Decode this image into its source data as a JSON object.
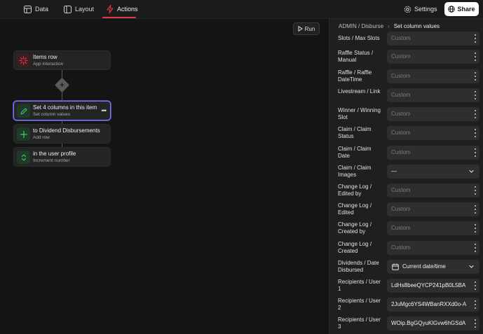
{
  "topbar": {
    "tabs": [
      {
        "label": "Data",
        "icon": "table-icon"
      },
      {
        "label": "Layout",
        "icon": "layout-icon"
      },
      {
        "label": "Actions",
        "icon": "lightning-icon",
        "active": true
      }
    ],
    "settings_label": "Settings",
    "share_label": "Share",
    "accent_color": "#e0393e"
  },
  "canvas": {
    "run_label": "Run",
    "nodes": [
      {
        "title": "Items row",
        "subtitle": "App interaction",
        "icon": "trigger-icon",
        "icon_color": "#e0393e"
      },
      {
        "title": "Set 4 columns in this item",
        "subtitle": "Set column values",
        "icon": "pencil-icon",
        "icon_color": "#3ec46d",
        "selected": true
      },
      {
        "title": "to Dividend Disbursements",
        "subtitle": "Add row",
        "icon": "plus-icon",
        "icon_color": "#3ec46d"
      },
      {
        "title": "in the user profile",
        "subtitle": "Increment number",
        "icon": "stepper-icon",
        "icon_color": "#3ec46d"
      }
    ]
  },
  "panel": {
    "breadcrumb_parent": "ADMIN / Disburse",
    "breadcrumb_separator": "›",
    "breadcrumb_current": "Set column values",
    "rows": [
      {
        "label": "Slots / Max Slots",
        "value": "Custom",
        "kind": "text"
      },
      {
        "label": "Raffle Status / Manual",
        "value": "Custom",
        "kind": "text"
      },
      {
        "label": "Raffle / Raffle DateTime",
        "value": "Custom",
        "kind": "text"
      },
      {
        "label": "Livestream / Link",
        "value": "Custom",
        "kind": "text"
      },
      {
        "label": "Winner / Winning Slot",
        "value": "Custom",
        "kind": "text"
      },
      {
        "label": "Claim / Claim Status",
        "value": "Custom",
        "kind": "text"
      },
      {
        "label": "Claim / Claim Date",
        "value": "Custom",
        "kind": "text"
      },
      {
        "label": "Claim / Claim Images",
        "value": "—",
        "kind": "select"
      },
      {
        "label": "Change Log / Edited by",
        "value": "Custom",
        "kind": "text"
      },
      {
        "label": "Change Log / Edited",
        "value": "Custom",
        "kind": "text"
      },
      {
        "label": "Change Log / Created by",
        "value": "Custom",
        "kind": "text"
      },
      {
        "label": "Change Log / Created",
        "value": "Custom",
        "kind": "text"
      },
      {
        "label": "Dividends / Date Disbursed",
        "value": "Current date/time",
        "kind": "date"
      },
      {
        "label": "Recipients / User 1",
        "value": "LdHs8beeQYCP241pB0L5BA",
        "kind": "filled"
      },
      {
        "label": "Recipients / User 2",
        "value": "2JuMgc6YS4WBanRXXd0o-A",
        "kind": "filled"
      },
      {
        "label": "Recipients / User 3",
        "value": "WOip.BgGQyuKlGvw6hGSdA",
        "kind": "filled"
      }
    ]
  }
}
